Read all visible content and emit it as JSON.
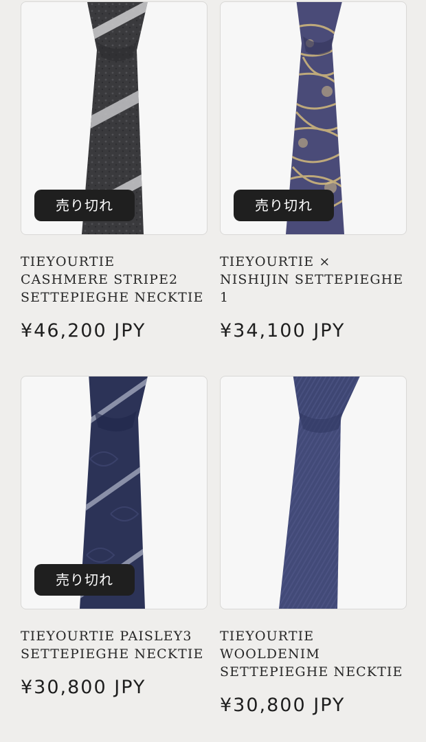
{
  "products": [
    {
      "title": "TIEYOURTIE CASHMERE STRIPE2 SETTEPIEGHE NECKTIE",
      "price": "¥46,200 JPY",
      "badge": "売り切れ",
      "sold_out": true,
      "colors": {
        "base": "#3c3c3f",
        "accent": "#bdbdbf"
      }
    },
    {
      "title": "TIEYOURTIE × NISHIJIN SETTEPIEGHE 1",
      "price": "¥34,100 JPY",
      "badge": "売り切れ",
      "sold_out": true,
      "colors": {
        "base": "#4b4c78",
        "accent": "#c8b17a"
      }
    },
    {
      "title": "TIEYOURTIE PAISLEY3 SETTEPIEGHE NECKTIE",
      "price": "¥30,800 JPY",
      "badge": "売り切れ",
      "sold_out": true,
      "colors": {
        "base": "#2c3357",
        "accent": "#8a90a8"
      }
    },
    {
      "title": "TIEYOURTIE WOOLDENIM SETTEPIEGHE NECKTIE",
      "price": "¥30,800 JPY",
      "badge": "",
      "sold_out": false,
      "colors": {
        "base": "#3e4673",
        "accent": "#56608e"
      }
    }
  ]
}
